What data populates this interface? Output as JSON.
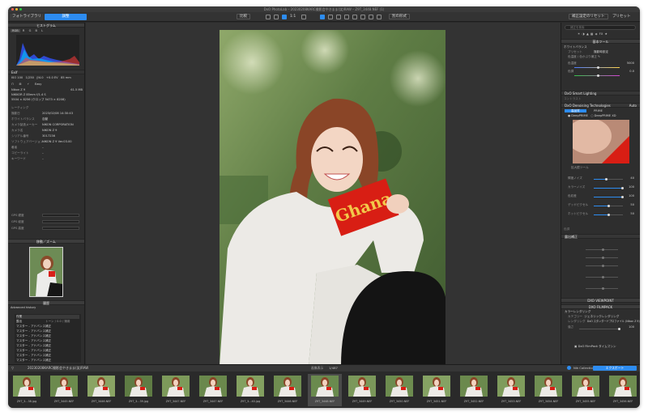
{
  "window": {
    "title": "DxO PhotoLab – 20230208KARC撮影会やきまま(笑)RAW – Z9T_3448.NEF (1)"
  },
  "toolbar": {
    "library_tab": "フォトライブラリ",
    "edit_tab": "調整",
    "compare_label": "比較",
    "zoom_label": "1:1",
    "export_label": "別の形式",
    "reset_label": "補正設定のリセット",
    "preset_label": "プリセット"
  },
  "left_panel": {
    "histogram": {
      "title": "ヒストグラム",
      "channels": [
        "RGB",
        "R",
        "G",
        "B",
        "L"
      ],
      "active_channel": "RGB"
    },
    "exif": {
      "title": "Exif",
      "row1": [
        "ISO 100",
        "1/250",
        "ƒ/4.0",
        "+0.0 EV",
        "85 mm"
      ],
      "file_size": "61.5 MB",
      "lens": "NIKKOR Z 85mm f/1.4 S",
      "dimensions": "5504 × 8256 (クロップ 5473 × 8208)",
      "mode_label": "Easy"
    },
    "metadata": [
      {
        "label": "レーティング",
        "value": ""
      },
      {
        "label": "撮影日",
        "value": "2023/02/08 14:30:43"
      },
      {
        "label": "ホワイトバランス",
        "value": "自動"
      },
      {
        "label": "カメラ製造メーカー",
        "value": "NIKON CORPORATION"
      },
      {
        "label": "カメラ名",
        "value": "NIKON Z 9"
      },
      {
        "label": "シリアル番号",
        "value": "3017236"
      },
      {
        "label": "ソフトウェアバージョン",
        "value": "NIKON Z 9 Ver.03.00"
      },
      {
        "label": "著者",
        "value": "–"
      },
      {
        "label": "コピーライト",
        "value": "–"
      },
      {
        "label": "キーワード",
        "value": "–"
      }
    ],
    "gps": [
      {
        "label": "GPS 緯度"
      },
      {
        "label": "GPS 経度"
      },
      {
        "label": "GPS 高度"
      }
    ],
    "navigator": {
      "title": "移動／ズーム"
    },
    "history": {
      "title": "履歴",
      "advanced_title": "Advanced history",
      "items": [
        {
          "name": "作業",
          "detail": ""
        },
        {
          "name": "露出",
          "detail": "トーン / 0.0 / 適用"
        },
        {
          "name": "マスター - アドバンス補正",
          "detail": ""
        },
        {
          "name": "マスター - アドバンス補正",
          "detail": ""
        },
        {
          "name": "マスター - アドバンス補正",
          "detail": ""
        },
        {
          "name": "マスター - アドバンス補正",
          "detail": ""
        },
        {
          "name": "マスター - アドバンス補正",
          "detail": ""
        },
        {
          "name": "マスター - アドバンス補正",
          "detail": ""
        },
        {
          "name": "マスター - アドバンス補正",
          "detail": ""
        },
        {
          "name": "マスター - アドバンス補正",
          "detail": ""
        }
      ]
    }
  },
  "right_panel": {
    "search_placeholder": "補正を検索",
    "basic_tools": "基本ツール",
    "white_balance": {
      "title": "ホワイトバランス",
      "preset_label": "プリセット",
      "preset_value": "撮影時設定",
      "color_label": "色温度 / 色かぶり補正",
      "temp_label": "色温度",
      "temp_value": "5000",
      "tint_label": "色調",
      "tint_value": "0.0"
    },
    "smart_lighting": "DxO Smart Lighting",
    "color_contrast": "コントラスト",
    "denoising": {
      "title": "DxO Denoising Technologies",
      "mode": "Auto",
      "tab1": "高品質",
      "tab2": "PRIME",
      "deepprime": "DeepPRIME",
      "deepprimexd": "DeepPRIME XD",
      "sliders": [
        {
          "label": "輝度ノイズ",
          "value": "40"
        },
        {
          "label": "カラーノイズ",
          "value": "100"
        },
        {
          "label": "色収差",
          "value": "100"
        },
        {
          "label": "デッドピクセル",
          "value": "50"
        },
        {
          "label": "ホットピクセル",
          "value": "50"
        }
      ]
    },
    "local_adjust": "色調",
    "viewpoint": "DXO VIEWPOINT",
    "filmpack": "DXO FILMPACK",
    "color_rendering": {
      "title": "カラーレンダリング",
      "category_label": "カテゴリー",
      "category_value": "ジェネリックレンダリング",
      "rendering_label": "レンダリング",
      "rendering_value": "DxO スタンダードプロファイル (Nikon Z 9)",
      "intensity_label": "強さ",
      "intensity_value": "100"
    },
    "filmpack_time": "DxO FilmPack タイムマシン"
  },
  "filmstrip": {
    "folder": "20230208KARC撮影会やきまま(笑)RAW",
    "count_label": "画像表示",
    "count_value": "1/487",
    "nik_label": "Nik Collection",
    "export_label": "エクスポート",
    "items": [
      {
        "name": "Z9T_3...38.jpg"
      },
      {
        "name": "Z9T_3445.NEF"
      },
      {
        "name": "Z9T_3446.NEF"
      },
      {
        "name": "Z9T_3...39.jpg"
      },
      {
        "name": "Z9T_3447.NEF"
      },
      {
        "name": "Z9T_3447.NEF"
      },
      {
        "name": "Z9T_3...40.jpg"
      },
      {
        "name": "Z9T_3446.NEF"
      },
      {
        "name": "Z9T_3448.NEF"
      },
      {
        "name": "Z9T_3449.NEF"
      },
      {
        "name": "Z9T_3450.NEF"
      },
      {
        "name": "Z9T_3451.NEF"
      },
      {
        "name": "Z9T_3452.NEF"
      },
      {
        "name": "Z9T_3453.NEF"
      },
      {
        "name": "Z9T_3454.NEF"
      },
      {
        "name": "Z9T_3455.NEF"
      },
      {
        "name": "Z9T_3456.NEF"
      }
    ]
  },
  "colors": {
    "accent": "#2d8cf0",
    "panel": "#2e2e2e",
    "viewer": "#333333"
  }
}
